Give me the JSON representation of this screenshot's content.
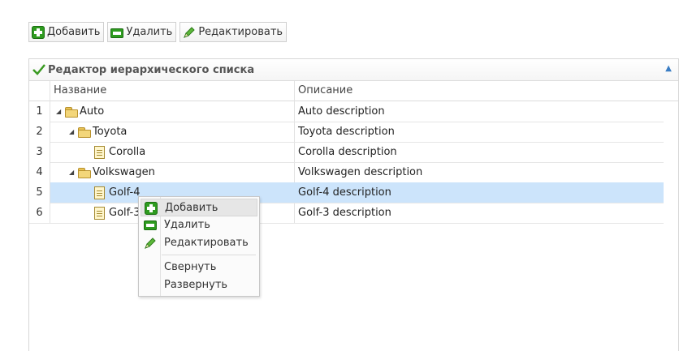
{
  "toolbar": {
    "add": "Добавить",
    "delete": "Удалить",
    "edit": "Редактировать"
  },
  "panel": {
    "title": "Редактор иерархического списка"
  },
  "grid": {
    "columns": {
      "name": "Название",
      "description": "Описание"
    },
    "rows": [
      {
        "num": "1",
        "name": "Auto",
        "description": "Auto description"
      },
      {
        "num": "2",
        "name": "Toyota",
        "description": "Toyota description"
      },
      {
        "num": "3",
        "name": "Corolla",
        "description": "Corolla description"
      },
      {
        "num": "4",
        "name": "Volkswagen",
        "description": "Volkswagen description"
      },
      {
        "num": "5",
        "name": "Golf-4",
        "description": "Golf-4 description"
      },
      {
        "num": "6",
        "name": "Golf-3",
        "description": "Golf-3 description"
      }
    ]
  },
  "context_menu": {
    "add": "Добавить",
    "delete": "Удалить",
    "edit": "Редактировать",
    "collapse": "Свернуть",
    "expand": "Развернуть"
  },
  "icons": {
    "add": "plus-icon",
    "delete": "minus-icon",
    "edit": "pencil-icon",
    "folder": "folder-icon",
    "file": "document-icon",
    "check": "check-icon"
  },
  "colors": {
    "selected_row": "#cce4fb",
    "accent_green": "#2e9b1f"
  }
}
